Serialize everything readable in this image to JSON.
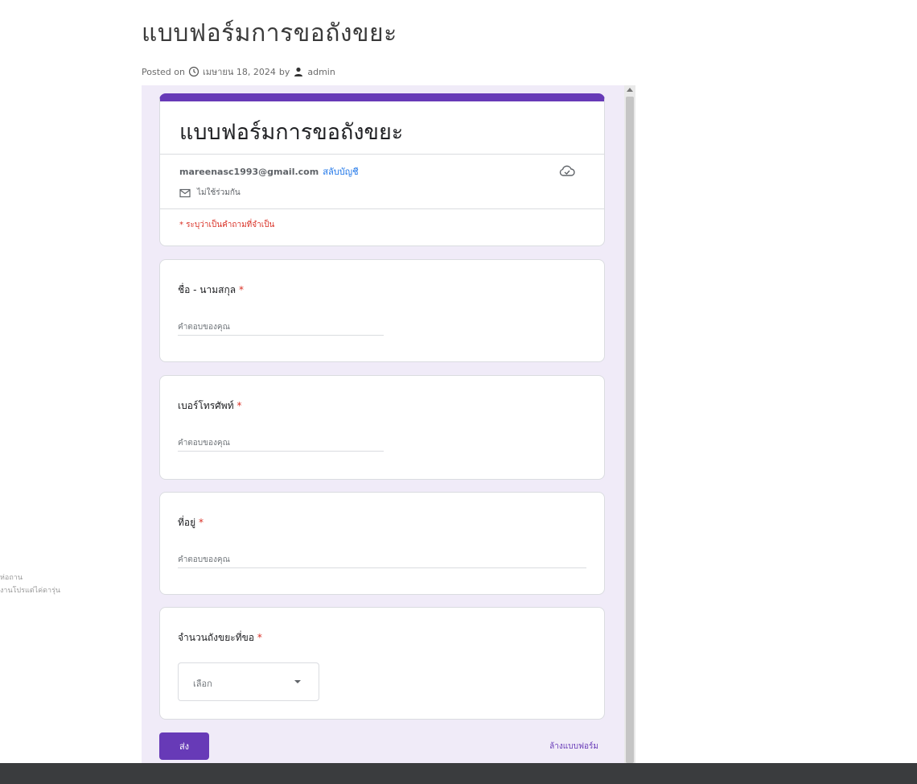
{
  "post": {
    "title": "แบบฟอร์มการขอถังขยะ",
    "meta_posted": "Posted on",
    "meta_date": "เมษายน 18, 2024",
    "meta_by": "by",
    "meta_author": "admin"
  },
  "side": {
    "line1": "ห่อถาน",
    "line2": "งานโปรแต่ไค่ดารุ่น"
  },
  "form": {
    "accent_color": "#673ab7",
    "title": "แบบฟอร์มการขอถังขยะ",
    "account_email": "mareenasc1993@gmail.com",
    "switch_account": "สลับบัญชี",
    "not_shared": "ไม่ใช้ร่วมกัน",
    "required_note": "* ระบุว่าเป็นคำถามที่จำเป็น",
    "questions": [
      {
        "label": "ชื่อ - นามสกุล",
        "required": "*",
        "placeholder": "คำตอบของคุณ"
      },
      {
        "label": "เบอร์โทรศัพท์",
        "required": "*",
        "placeholder": "คำตอบของคุณ"
      },
      {
        "label": "ที่อยู่",
        "required": "*",
        "placeholder": "คำตอบของคุณ"
      },
      {
        "label": "จำนวนถังขยะที่ขอ",
        "required": "*",
        "select_value": "เลือก"
      }
    ],
    "submit_label": "ส่ง",
    "clear_label": "ล้างแบบฟอร์ม"
  },
  "icons": {
    "clock": "clock-icon",
    "user": "user-icon",
    "cloud": "cloud-done-icon",
    "mail": "mail-off-icon",
    "dropdown": "caret-down-icon"
  }
}
